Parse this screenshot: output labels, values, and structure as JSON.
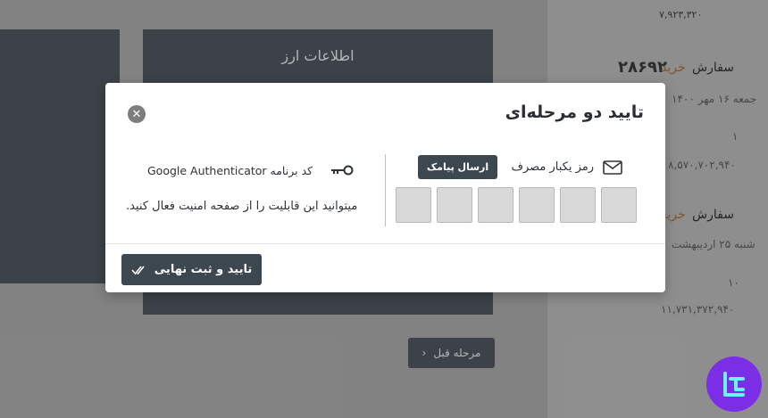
{
  "background": {
    "card_header": "اطلاعات ارز",
    "order_label_1": "سفارش",
    "order_status_1": "خرید",
    "order_number_1": "۲۸۶۹۲",
    "order_date_1": "جمعه ۱۶ مهر ۱۴۰۰",
    "order_value_1": "۱",
    "order_amount_1": "۸,۵۷۰,۷۰۲,۹۴۰",
    "top_amount": "۷,۹۲۳,۳۲۰",
    "order_label_2": "سفارش",
    "order_status_2": "خرید",
    "order_date_2": "شنبه ۲۵ اردیبهشت",
    "order_value_2": "۱۰",
    "order_amount_2": "۱۱,۷۳۱,۳۷۲,۹۴۰",
    "prev_step": "مرحله قبل"
  },
  "modal": {
    "title": "تایید دو مرحله‌ای",
    "otp_label": "رمز یکبار مصرف",
    "sms_button": "ارسال پیامک",
    "ga_label": "کد برنامه Google Authenticator",
    "ga_description": "میتوانید این قابلیت را از صفحه امنیت فعال کنید.",
    "confirm_button": "تایید و ثبت نهایی"
  },
  "colors": {
    "primary_dark": "#3d4750",
    "brand_purple": "#7b2ee6"
  }
}
